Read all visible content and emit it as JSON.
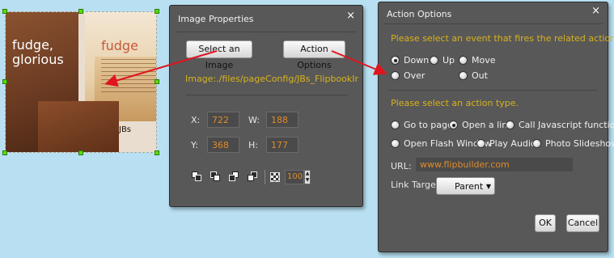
{
  "thumbnail": {
    "caption_left": "fudge,\nglorious",
    "caption_right": "fudge",
    "caption_small": "JBs"
  },
  "image_properties": {
    "title": "Image Properties",
    "close_label": "×",
    "select_image_label": "Select an Image",
    "action_options_label": "Action Options",
    "path": "Image:./files/pageConfig/JBs_FlipbookImage.jpg",
    "x_label": "X:",
    "x_value": "722",
    "w_label": "W:",
    "w_value": "188",
    "y_label": "Y:",
    "y_value": "368",
    "h_label": "H:",
    "h_value": "177",
    "opacity_value": "100"
  },
  "action_options": {
    "title": "Action Options",
    "close_label": "×",
    "event_prompt": "Please select an event that fires the related action.",
    "events": [
      {
        "label": "Down",
        "checked": true
      },
      {
        "label": "Up",
        "checked": false
      },
      {
        "label": "Move",
        "checked": false
      },
      {
        "label": "Over",
        "checked": false
      },
      {
        "label": "Out",
        "checked": false
      }
    ],
    "action_prompt": "Please select an action type.",
    "actions": [
      {
        "label": "Go to page",
        "checked": false
      },
      {
        "label": "Open a link",
        "checked": true
      },
      {
        "label": "Call Javascript function",
        "checked": false
      },
      {
        "label": "Open Flash Window",
        "checked": false
      },
      {
        "label": "Play Audio",
        "checked": false
      },
      {
        "label": "Photo Slideshow",
        "checked": false
      }
    ],
    "url_label": "URL:",
    "url_value": "www.flipbuilder.com",
    "link_target_label": "Link Target:",
    "link_target_value": "Parent",
    "ok_label": "OK",
    "cancel_label": "Cancel"
  },
  "colors": {
    "background": "#b8e0f2",
    "dialog": "#585858",
    "accent_yellow": "#d7b21f",
    "value_orange": "#e08a2a",
    "arrow_red": "#e0141e"
  }
}
